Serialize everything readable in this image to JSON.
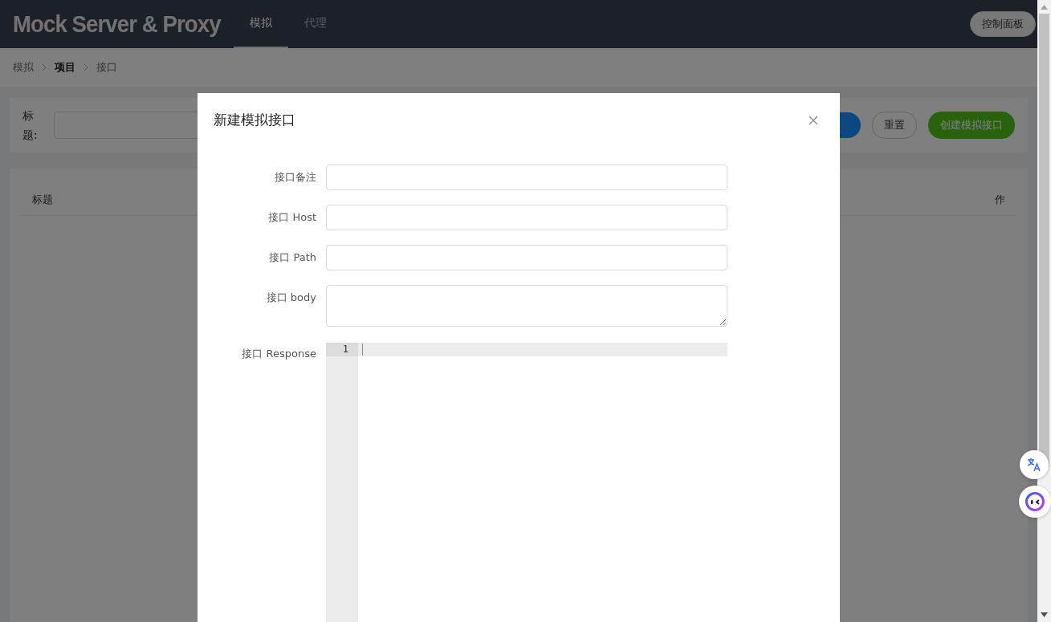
{
  "header": {
    "logo": "Mock Server & Proxy",
    "tabs": [
      {
        "label": "模拟",
        "selected": true
      },
      {
        "label": "代理",
        "selected": false
      }
    ],
    "dashboard_button": "控制面板"
  },
  "breadcrumb": [
    {
      "label": "模拟",
      "emphasized": false
    },
    {
      "label": "项目",
      "emphasized": true
    },
    {
      "label": "接口",
      "emphasized": false
    }
  ],
  "filter": {
    "label": "标题:",
    "buttons": [
      {
        "label": "重置",
        "kind": "default"
      },
      {
        "label": "创建模拟接口",
        "kind": "primary"
      }
    ]
  },
  "table": {
    "columns": [
      "标题",
      "作"
    ]
  },
  "dialog": {
    "title": "新建模拟接口",
    "fields": [
      {
        "label": "接口备注",
        "kind": "input"
      },
      {
        "label": "接口 Host",
        "kind": "input"
      },
      {
        "label": "接口 Path",
        "kind": "input"
      },
      {
        "label": "接口 body",
        "kind": "textarea"
      },
      {
        "label": "接口 Response",
        "kind": "code",
        "line_numbers": [
          "1"
        ]
      }
    ]
  }
}
